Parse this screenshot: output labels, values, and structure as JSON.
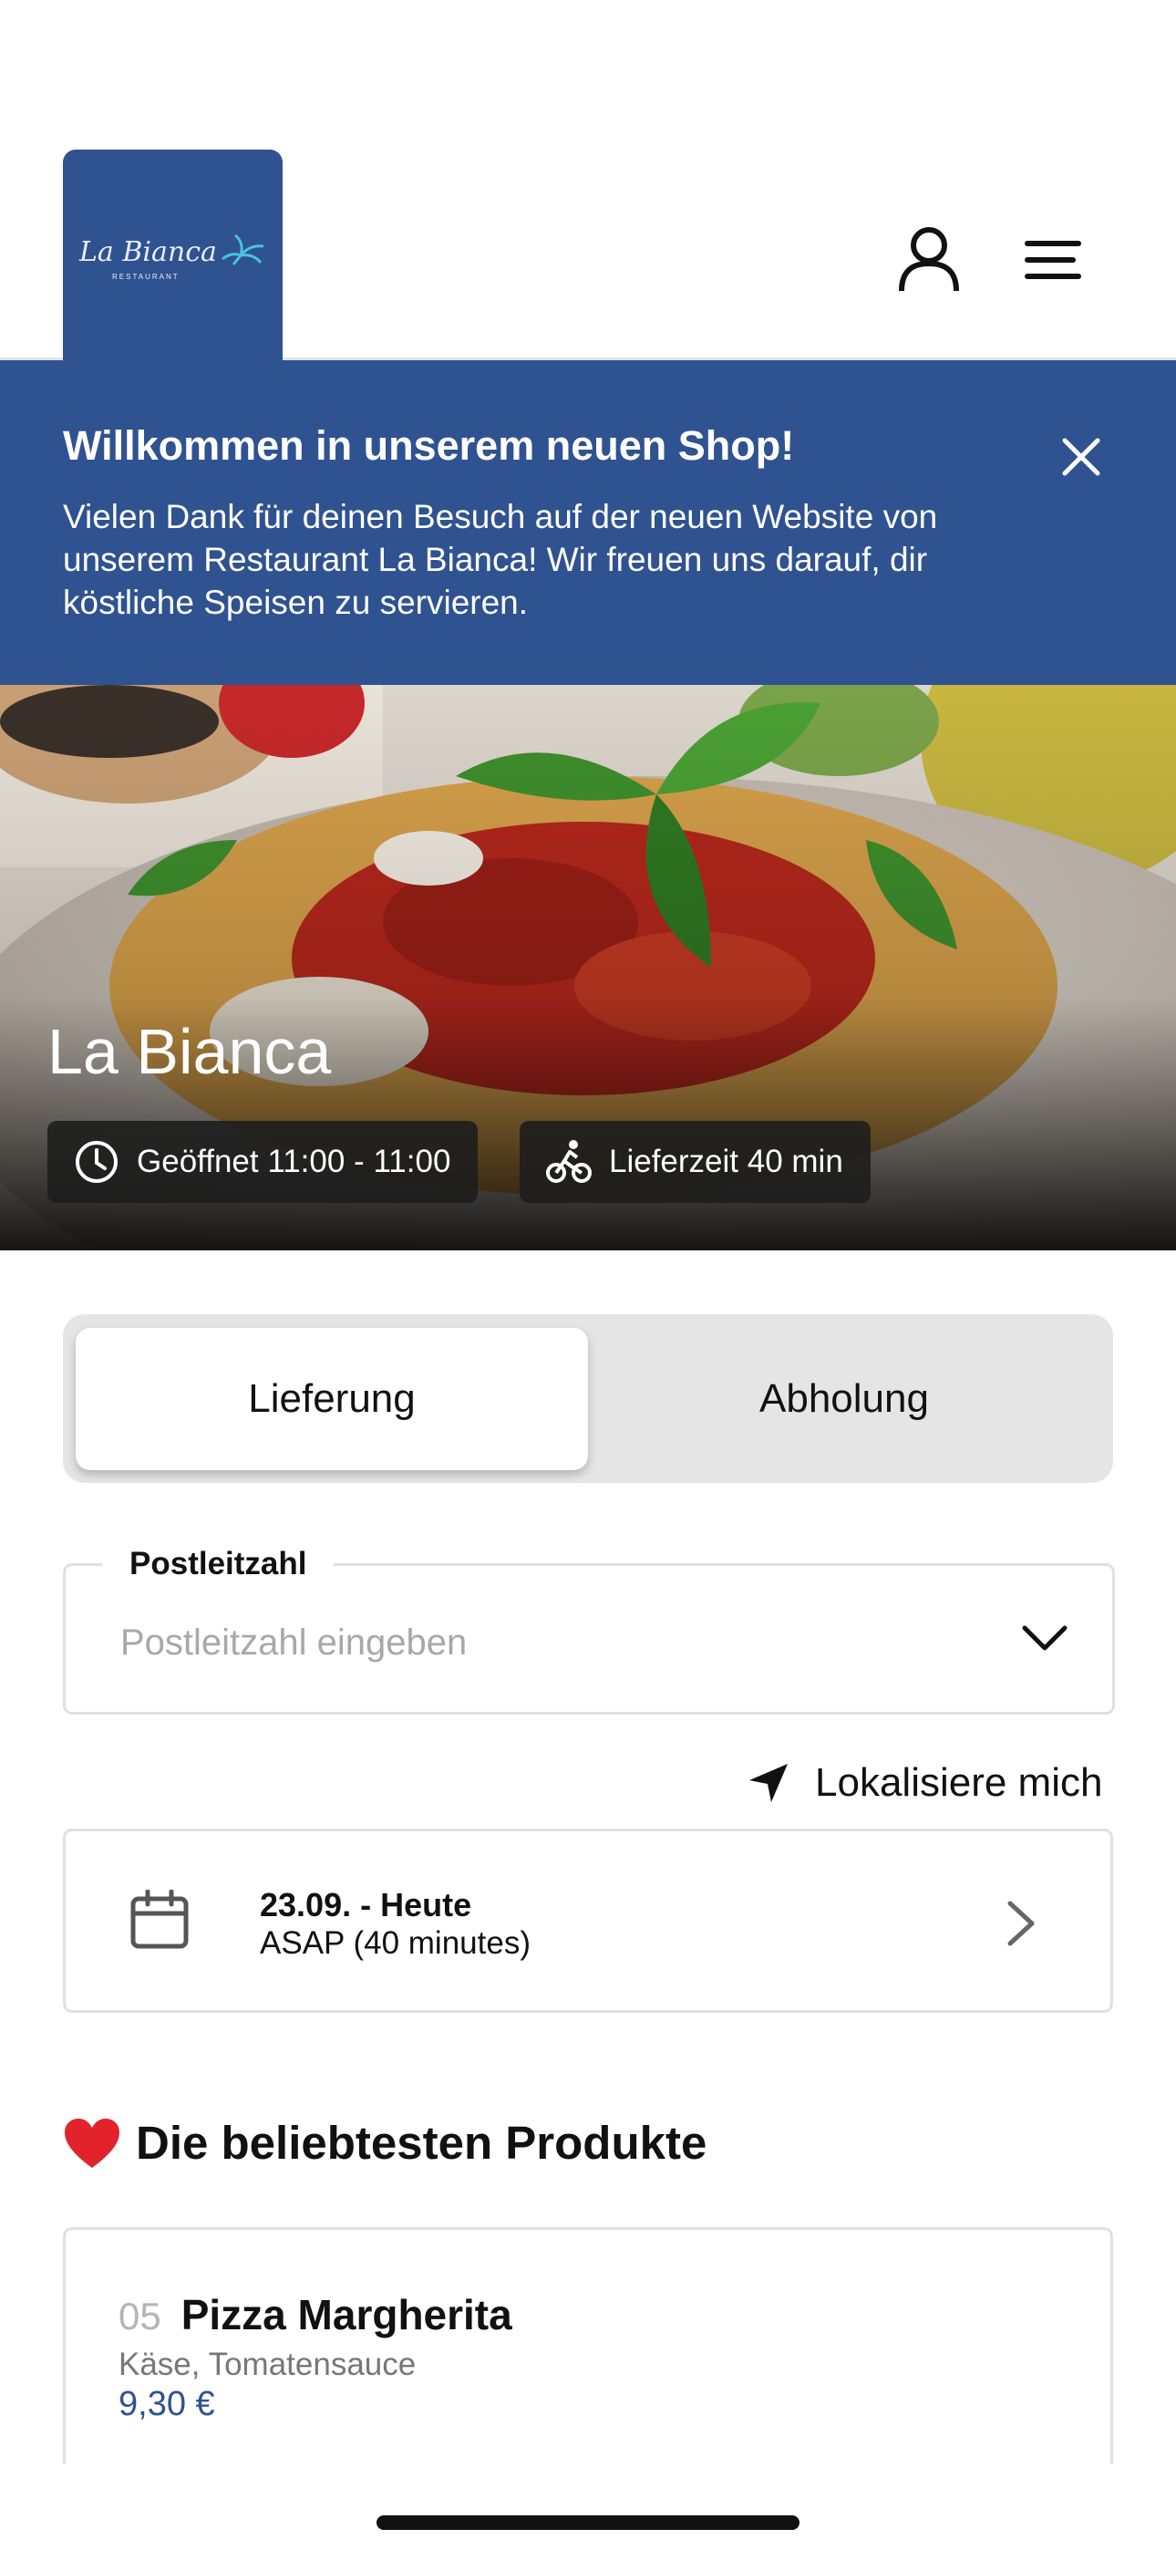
{
  "header": {
    "logo_text": "La Bianca",
    "logo_subtext": "RESTAURANT",
    "brand_color": "#2f5291",
    "icons": [
      "user-icon",
      "menu-icon"
    ]
  },
  "banner": {
    "title": "Willkommen in unserem neuen Shop!",
    "text": "Vielen Dank für deinen Besuch auf der neuen Website von unserem Restaurant La Bianca! Wir freuen uns darauf, dir köstliche Speisen zu servieren.",
    "close_icon": "close-icon"
  },
  "hero": {
    "title": "La Bianca",
    "opening": "Geöffnet 11:00 - 11:00",
    "delivery_time": "Lieferzeit 40 min"
  },
  "order_mode": {
    "options": [
      "Lieferung",
      "Abholung"
    ],
    "selected": "Lieferung"
  },
  "zip": {
    "label": "Postleitzahl",
    "placeholder": "Postleitzahl eingeben"
  },
  "locate_label": "Lokalisiere mich",
  "date": {
    "title": "23.09. - Heute",
    "subtitle": "ASAP (40 minutes)"
  },
  "popular": {
    "title": "Die beliebtesten Produkte",
    "products": [
      {
        "number": "05",
        "name": "Pizza Margherita",
        "description": "Käse, Tomatensauce",
        "price": "9,30 €"
      }
    ]
  }
}
